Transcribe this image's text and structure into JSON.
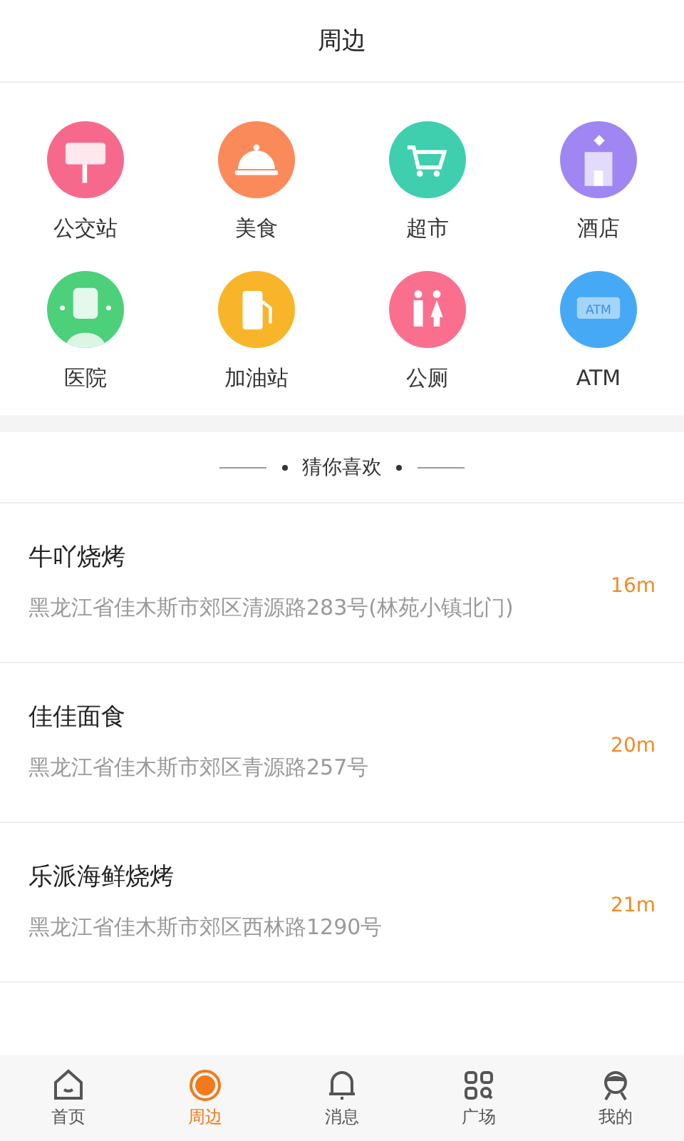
{
  "header": {
    "title": "周边"
  },
  "categories": [
    {
      "label": "公交站",
      "kind": "bus",
      "color": "#f7698c"
    },
    {
      "label": "美食",
      "kind": "food",
      "color": "#fb8a5a"
    },
    {
      "label": "超市",
      "kind": "market",
      "color": "#3fcfae"
    },
    {
      "label": "酒店",
      "kind": "hotel",
      "color": "#9f86f2"
    },
    {
      "label": "医院",
      "kind": "hospital",
      "color": "#4cd07a"
    },
    {
      "label": "加油站",
      "kind": "fuel",
      "color": "#f8b52a"
    },
    {
      "label": "公厕",
      "kind": "toilet",
      "color": "#fb6f8e"
    },
    {
      "label": "ATM",
      "kind": "atm",
      "color": "#46a9f5",
      "icon_text": "ATM"
    }
  ],
  "section": {
    "title": "猜你喜欢"
  },
  "places": [
    {
      "name": "牛吖烧烤",
      "address": "黑龙江省佳木斯市郊区清源路283号(林苑小镇北门)",
      "distance": "16m"
    },
    {
      "name": "佳佳面食",
      "address": "黑龙江省佳木斯市郊区青源路257号",
      "distance": "20m"
    },
    {
      "name": "乐派海鲜烧烤",
      "address": "黑龙江省佳木斯市郊区西林路1290号",
      "distance": "21m"
    }
  ],
  "tabs": [
    {
      "label": "首页",
      "kind": "home",
      "selected": false
    },
    {
      "label": "周边",
      "kind": "nearby",
      "selected": true
    },
    {
      "label": "消息",
      "kind": "bell",
      "selected": false
    },
    {
      "label": "广场",
      "kind": "grid",
      "selected": false
    },
    {
      "label": "我的",
      "kind": "user",
      "selected": false
    }
  ]
}
